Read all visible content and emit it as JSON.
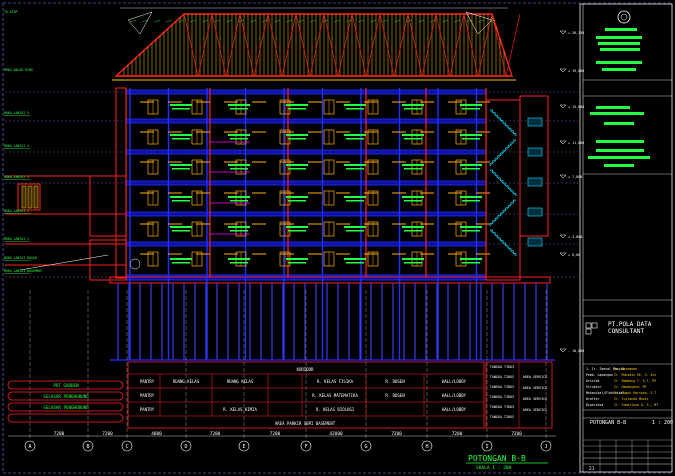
{
  "drawing": {
    "title": "POTONGAN B-B",
    "scale": "SKALA 1 : 200",
    "top_left_label": "TO ATAP",
    "ridge_label": "MUKA BALOK RING"
  },
  "level_labels_left": [
    "MUKA LANTAI 5",
    "MUKA LANTAI 4",
    "MUKA LANTAI 3",
    "MUKA LANTAI 2",
    "MUKA LANTAI 1",
    "MUKA LANTAI DASAR",
    "MUKA LANTAI BASEMENT"
  ],
  "elevations_right": [
    "+ 26,350",
    "+ 19,800",
    "+ 15,800",
    "+ 11,800",
    "+ 7,800",
    "+ 3,800",
    "+ 0,00",
    "- 10,800"
  ],
  "grid_axes": [
    "A",
    "B",
    "C",
    "D",
    "E",
    "F",
    "G",
    "H",
    "I",
    "J"
  ],
  "grid_dimensions": [
    "7200",
    "7200",
    "4800",
    "7200",
    "7200",
    "42000",
    "7200",
    "7200",
    "7200"
  ],
  "room_labels": {
    "left_block": [
      "POT GARDEN",
      "SELASAR PENGHUBUNG",
      "SELASAR PENGHUBUNG"
    ],
    "basement": [
      "PANTRY",
      "PANTRY",
      "PANTRY",
      "RUANG KELAS",
      "RUANG KELAS",
      "R. KELAS FISIKA",
      "R. KELAS KIMIA",
      "R. KELAS MATEMATIKA",
      "R. KELAS BIOLOGI",
      "R. DOSEN",
      "R. DOSEN",
      "KORIDOR",
      "HALL/LOBBY",
      "HALL/LOBBY",
      "HALL/LOBBY",
      "AREA PARKIR SEMI BASEMENT"
    ],
    "right_block": [
      "TANGGA TIKUS",
      "TANGGA TIKUS",
      "TANGGA TIKUS",
      "TANGGA TIKUS",
      "TANGGA TIKUS",
      "TANGGA TIKUS",
      "AREA SERVICE",
      "AREA SERVICE",
      "AREA SERVICE",
      "AREA SERVICE"
    ]
  },
  "title_block": {
    "consultant_name": "PT.POLA DATA",
    "consultant_sub": "CONSULTANT",
    "sheet_title": "POTONGAN B-B",
    "sheet_scale": "1 : 200",
    "sheet_number": "21"
  },
  "colors": {
    "background": "#000000",
    "wall": "#ff2020",
    "column": "#2030ff",
    "roof": "#ffcc00",
    "text": "#00ff40",
    "stair": "#00e0ff",
    "window": "#ffb000",
    "magenta": "#ff00ff"
  }
}
